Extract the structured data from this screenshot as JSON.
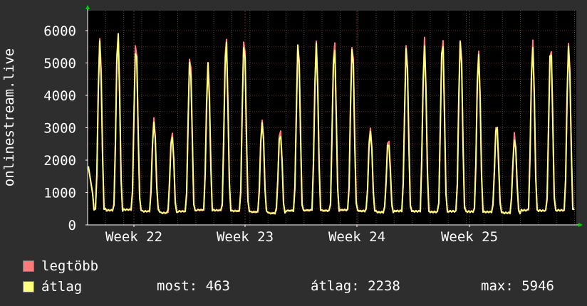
{
  "chart_data": {
    "type": "line",
    "ylabel": "onlinestream.live",
    "ylim": [
      0,
      6200
    ],
    "yticks": [
      0,
      1000,
      2000,
      3000,
      4000,
      5000,
      6000
    ],
    "x_labels": [
      "Week 22",
      "Week 23",
      "Week 24",
      "Week 25"
    ],
    "grid": true,
    "series": [
      {
        "name": "legtöbb",
        "color": "#ff7b7b",
        "daily_peaks": [
          5800,
          6000,
          5700,
          3300,
          2900,
          5300,
          5050,
          5850,
          5850,
          3300,
          3000,
          5700,
          5650,
          5700,
          5700,
          3050,
          2700,
          5600,
          5700,
          5850,
          5850,
          5400,
          3200,
          2800,
          5650,
          5650,
          5650
        ]
      },
      {
        "name": "átlag",
        "color": "#ffff80",
        "daily_peaks": [
          5650,
          5900,
          5600,
          3200,
          2800,
          5150,
          4900,
          5700,
          5700,
          3200,
          2900,
          5600,
          5550,
          5550,
          5550,
          2950,
          2600,
          5500,
          5550,
          5750,
          5750,
          5300,
          3100,
          2700,
          5550,
          5550,
          5550
        ]
      }
    ],
    "daily_lows": [
      480,
      450,
      470,
      420,
      370,
      420,
      460,
      450,
      430,
      400,
      360,
      440,
      450,
      440,
      460,
      430,
      390,
      430,
      420,
      400,
      420,
      410,
      400,
      370,
      450,
      440,
      450
    ],
    "start_value": 1950,
    "end_value": 463
  },
  "legend": {
    "max_label": "legtöbb",
    "avg_label": "átlag",
    "max_color": "#ff7b7b",
    "avg_color": "#ffff80"
  },
  "stats": {
    "current": "most: 463",
    "average": "átlag: 2238",
    "maximum": "max: 5946"
  }
}
